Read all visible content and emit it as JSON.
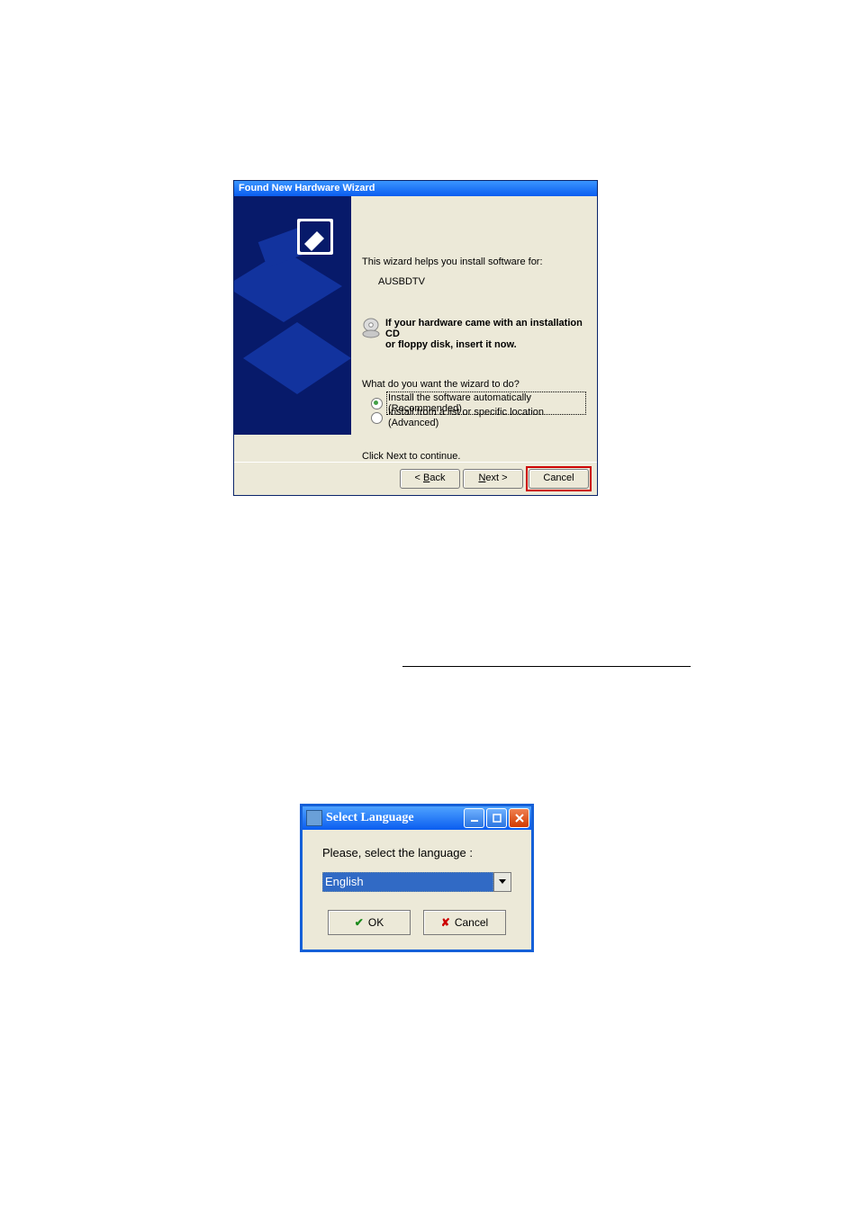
{
  "wizard": {
    "title": "Found New Hardware Wizard",
    "intro": "This wizard helps you install software for:",
    "device": "AUSBDTV",
    "cd_msg_line1": "If your hardware came with an installation CD",
    "cd_msg_line2": "or floppy disk, insert it now.",
    "question": "What do you want the wizard to do?",
    "radio1": "Install the software automatically (Recommended)",
    "radio2": "Install from a list or specific location (Advanced)",
    "continue": "Click Next to continue.",
    "btn_back": "< Back",
    "btn_next": "Next >",
    "btn_cancel": "Cancel"
  },
  "lang_dialog": {
    "title": "Select Language",
    "prompt": "Please, select the language :",
    "selected": "English",
    "ok": "OK",
    "cancel": "Cancel"
  }
}
